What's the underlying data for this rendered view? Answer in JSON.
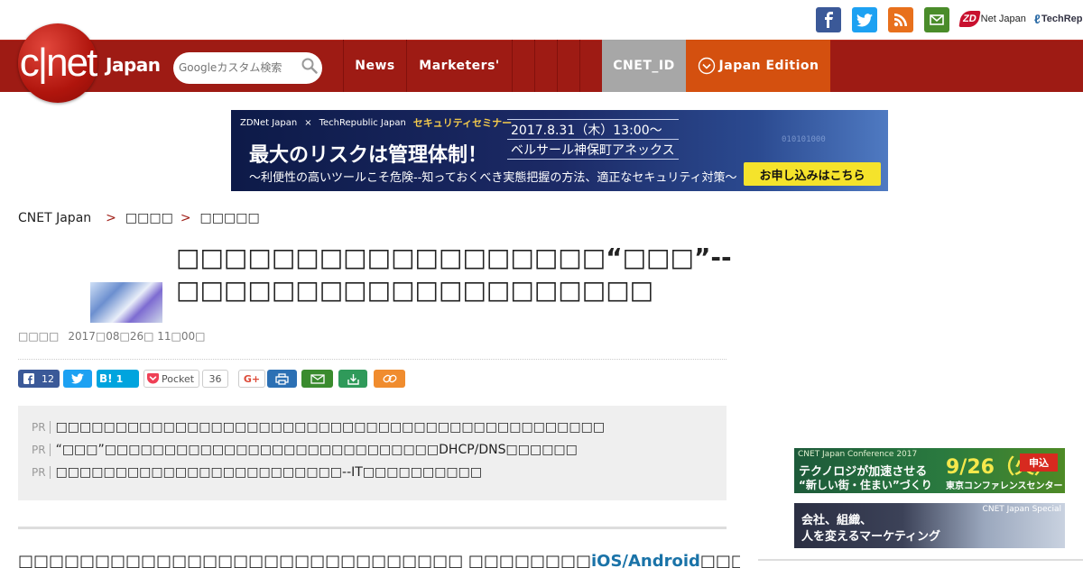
{
  "social": {
    "zdnet_mark": "ZD",
    "zdnet_text": "Net Japan",
    "techrepublic_text": "TechRep"
  },
  "nav": {
    "logo_text": "c|net",
    "edition_label": "Japan",
    "search_placeholder": "Googleカスタム検索",
    "items": [
      "News",
      "Marketers'"
    ],
    "cnet_id": "CNET_ID",
    "japan_edition": "Japan Edition"
  },
  "banner": {
    "brand_zd": "ZDNet Japan",
    "brand_x": "×",
    "brand_tr": "TechRepublic Japan",
    "seminar": "セキュリティセミナー",
    "date": "2017.8.31（木）13:00～",
    "venue": "ベルサール神保町アネックス",
    "headline": "最大のリスクは管理体制！",
    "subline": "～利便性の高いツールこそ危険--知っておくべき実態把握の方法、適正なセキュリティ対策～",
    "cta": "お申し込みはこちら",
    "bits": "010101000"
  },
  "breadcrumb": {
    "root": "CNET Japan",
    "sep": ">",
    "level1": "□□□□",
    "level2": "□□□□□"
  },
  "article": {
    "title": "□□□□□□□□□□□□□□□□□□“□□□”--□□□□□□□□□□□□□□□□□□□□",
    "author": "□□□□",
    "datetime": "2017□08□26□ 11□00□"
  },
  "share": {
    "fb_count": "12",
    "hatena_label": "B!",
    "hatena_count": "1",
    "pocket_label": "Pocket",
    "pocket_count": "36",
    "gplus_label": "G+"
  },
  "pr": {
    "tag": "PR",
    "items": [
      "□□□□□□□□□□□□□□□□□□□□□□□□□□□□□□□□□□□□□□□□□□□□□□",
      "“□□□”□□□□□□□□□□□□□□□□□□□□□□□□□□□□DHCP/DNS□□□□□□",
      "□□□□□□□□□□□□□□□□□□□□□□□□--IT□□□□□□□□□□"
    ]
  },
  "body": {
    "lead": "□□□□□□□□□□□□□□□□□□□□□□□□□□□□□ □□□□□□□□",
    "link": "iOS/Android",
    "rest": "□□□□□□□□□□□□□□□□□□□□□□□□□□□"
  },
  "side_ads": {
    "ad1_top": "CNET Japan Conference 2017",
    "ad1_line1": "テクノロジが加速させる",
    "ad1_line2": "“新しい街・住まい”づくり",
    "ad1_date": "9/26（火）",
    "ad1_venue": "東京コンファレンスセンター",
    "ad1_btn": "申込",
    "ad2_tag": "CNET Japan Special",
    "ad2_line1": "会社、組織、",
    "ad2_line2": "人を変えるマーケティング"
  },
  "colors": {
    "nav_red": "#9e1b14",
    "cnet_id_gray": "#a7a7a7",
    "japan_edition_orange": "#d4500f",
    "link_blue": "#1a73a8"
  }
}
